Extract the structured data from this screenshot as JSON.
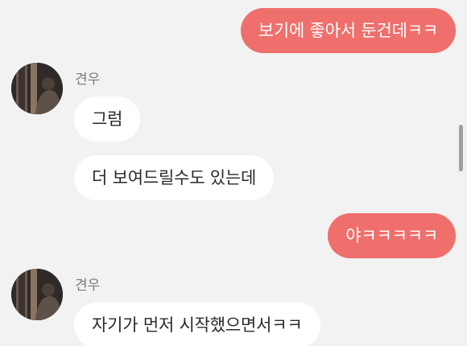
{
  "conversation": {
    "sender_name": "견우",
    "messages": [
      {
        "direction": "sent",
        "text": "보기에 좋아서 둔건데ㅋㅋ"
      },
      {
        "direction": "received",
        "sender": "견우",
        "text": "그럼"
      },
      {
        "direction": "received",
        "sender": "견우",
        "text": "더 보여드릴수도 있는데"
      },
      {
        "direction": "sent",
        "text": "야ㅋㅋㅋㅋㅋ"
      },
      {
        "direction": "received",
        "sender": "견우",
        "text": "자기가 먼저 시작했으면서ㅋㅋ"
      }
    ]
  },
  "colors": {
    "background": "#f2f2f2",
    "sent_bubble": "#ef6f6c",
    "received_bubble": "#ffffff",
    "sender_name": "#7a7a7a"
  }
}
